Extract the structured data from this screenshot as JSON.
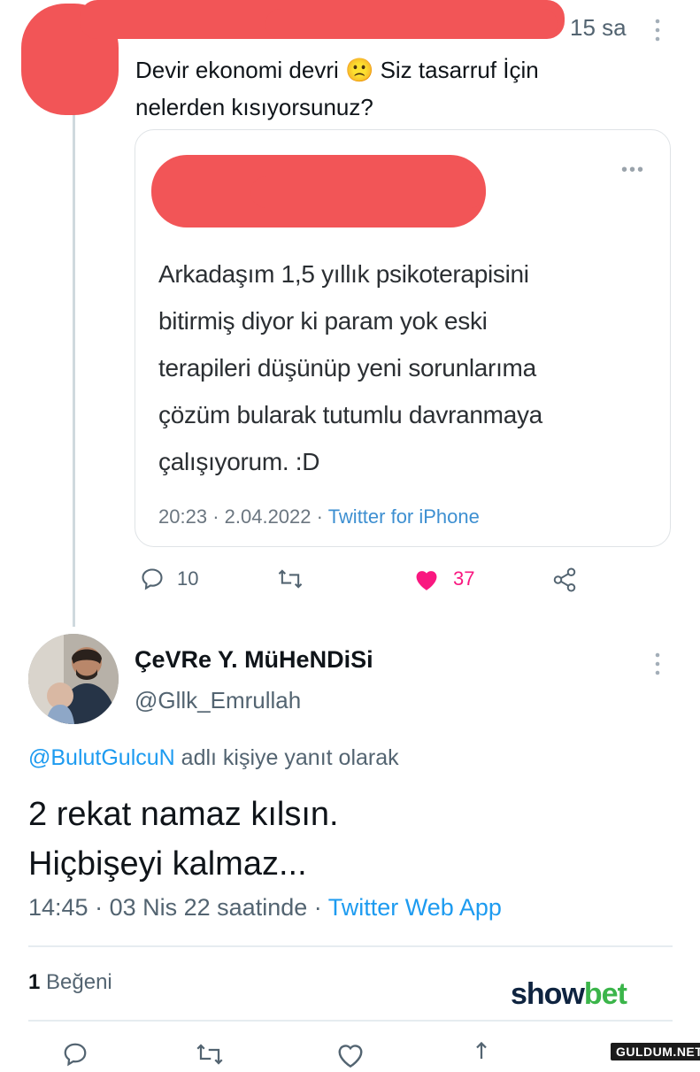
{
  "top_tweet": {
    "time": "15 sa",
    "text_line1": "Devir ekonomi devri 🙁 Siz tasarruf İçin",
    "text_line2": "nelerden kısıyorsunuz?",
    "quote": {
      "text_lines": [
        "Arkadaşım 1,5 yıllık psikoterapisini",
        "bitirmiş diyor ki param yok eski",
        "terapileri düşünüp yeni sorunlarıma",
        "çözüm bularak tutumlu davranmaya",
        "çalışıyorum. :D"
      ],
      "time": "20:23",
      "date": "2.04.2022",
      "source": "Twitter for iPhone",
      "more_icon": "ellipsis-icon"
    },
    "actions": {
      "reply_count": "10",
      "retweet_count": "",
      "like_count": "37",
      "like_color": "#f91880"
    }
  },
  "reply_tweet": {
    "name": "ÇeVRe Y. MüHeNDiSi",
    "handle": "@Gllk_Emrullah",
    "reply_to_mention": "@BulutGulcuN",
    "reply_to_suffix": " adlı kişiye yanıt olarak",
    "text_line1": "2 rekat namaz kılsın.",
    "text_line2": "Hiçbişeyi kalmaz...",
    "time": "14:45",
    "date": "03 Nis 22 saatinde",
    "source": "Twitter Web App",
    "likes_count": "1",
    "likes_label": "Beğeni"
  },
  "watermarks": {
    "showbet_part1": "show",
    "showbet_part2": "bet",
    "site": "GULDUM.NET"
  },
  "colors": {
    "accent": "#1d9bf0",
    "redaction": "#f25557",
    "showbet_dark": "#0f2440",
    "showbet_green": "#3bb54a"
  }
}
